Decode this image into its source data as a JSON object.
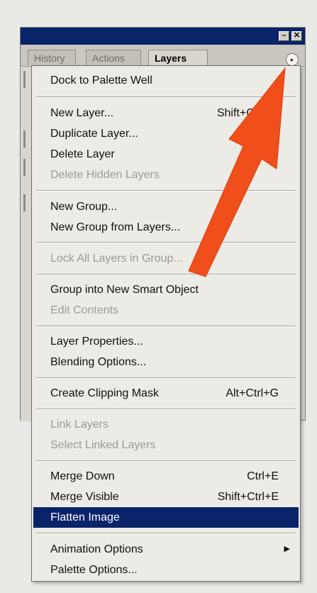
{
  "palette": {
    "tabs": [
      "History",
      "Actions",
      "Layers"
    ],
    "minimize_glyph": "–",
    "close_glyph": "✕",
    "menu_button_glyph": "▸"
  },
  "menu": {
    "items": [
      {
        "label": "Dock to Palette Well",
        "shortcut": "",
        "disabled": false
      },
      {
        "label": "New Layer...",
        "shortcut": "Shift+Ctrl+N",
        "disabled": false
      },
      {
        "label": "Duplicate Layer...",
        "shortcut": "",
        "disabled": false
      },
      {
        "label": "Delete Layer",
        "shortcut": "",
        "disabled": false
      },
      {
        "label": "Delete Hidden Layers",
        "shortcut": "",
        "disabled": true
      },
      {
        "label": "New Group...",
        "shortcut": "",
        "disabled": false
      },
      {
        "label": "New Group from Layers...",
        "shortcut": "",
        "disabled": false
      },
      {
        "label": "Lock All Layers in Group...",
        "shortcut": "",
        "disabled": true
      },
      {
        "label": "Group into New Smart Object",
        "shortcut": "",
        "disabled": false
      },
      {
        "label": "Edit Contents",
        "shortcut": "",
        "disabled": true
      },
      {
        "label": "Layer Properties...",
        "shortcut": "",
        "disabled": false
      },
      {
        "label": "Blending Options...",
        "shortcut": "",
        "disabled": false
      },
      {
        "label": "Create Clipping Mask",
        "shortcut": "Alt+Ctrl+G",
        "disabled": false
      },
      {
        "label": "Link Layers",
        "shortcut": "",
        "disabled": true
      },
      {
        "label": "Select Linked Layers",
        "shortcut": "",
        "disabled": true
      },
      {
        "label": "Merge Down",
        "shortcut": "Ctrl+E",
        "disabled": false
      },
      {
        "label": "Merge Visible",
        "shortcut": "Shift+Ctrl+E",
        "disabled": false
      },
      {
        "label": "Flatten Image",
        "shortcut": "",
        "disabled": false,
        "selected": true
      },
      {
        "label": "Animation Options",
        "shortcut": "",
        "disabled": false,
        "submenu_glyph": "▶"
      },
      {
        "label": "Palette Options...",
        "shortcut": "",
        "disabled": false
      }
    ]
  },
  "colors": {
    "titlebar": "#0a246a",
    "selection": "#0a246a",
    "annotation_arrow": "#f04e1a",
    "disabled_text": "#9c9b96"
  },
  "annotation": {
    "icon": "orange-arrow-pointing-to-palette-menu-button"
  }
}
